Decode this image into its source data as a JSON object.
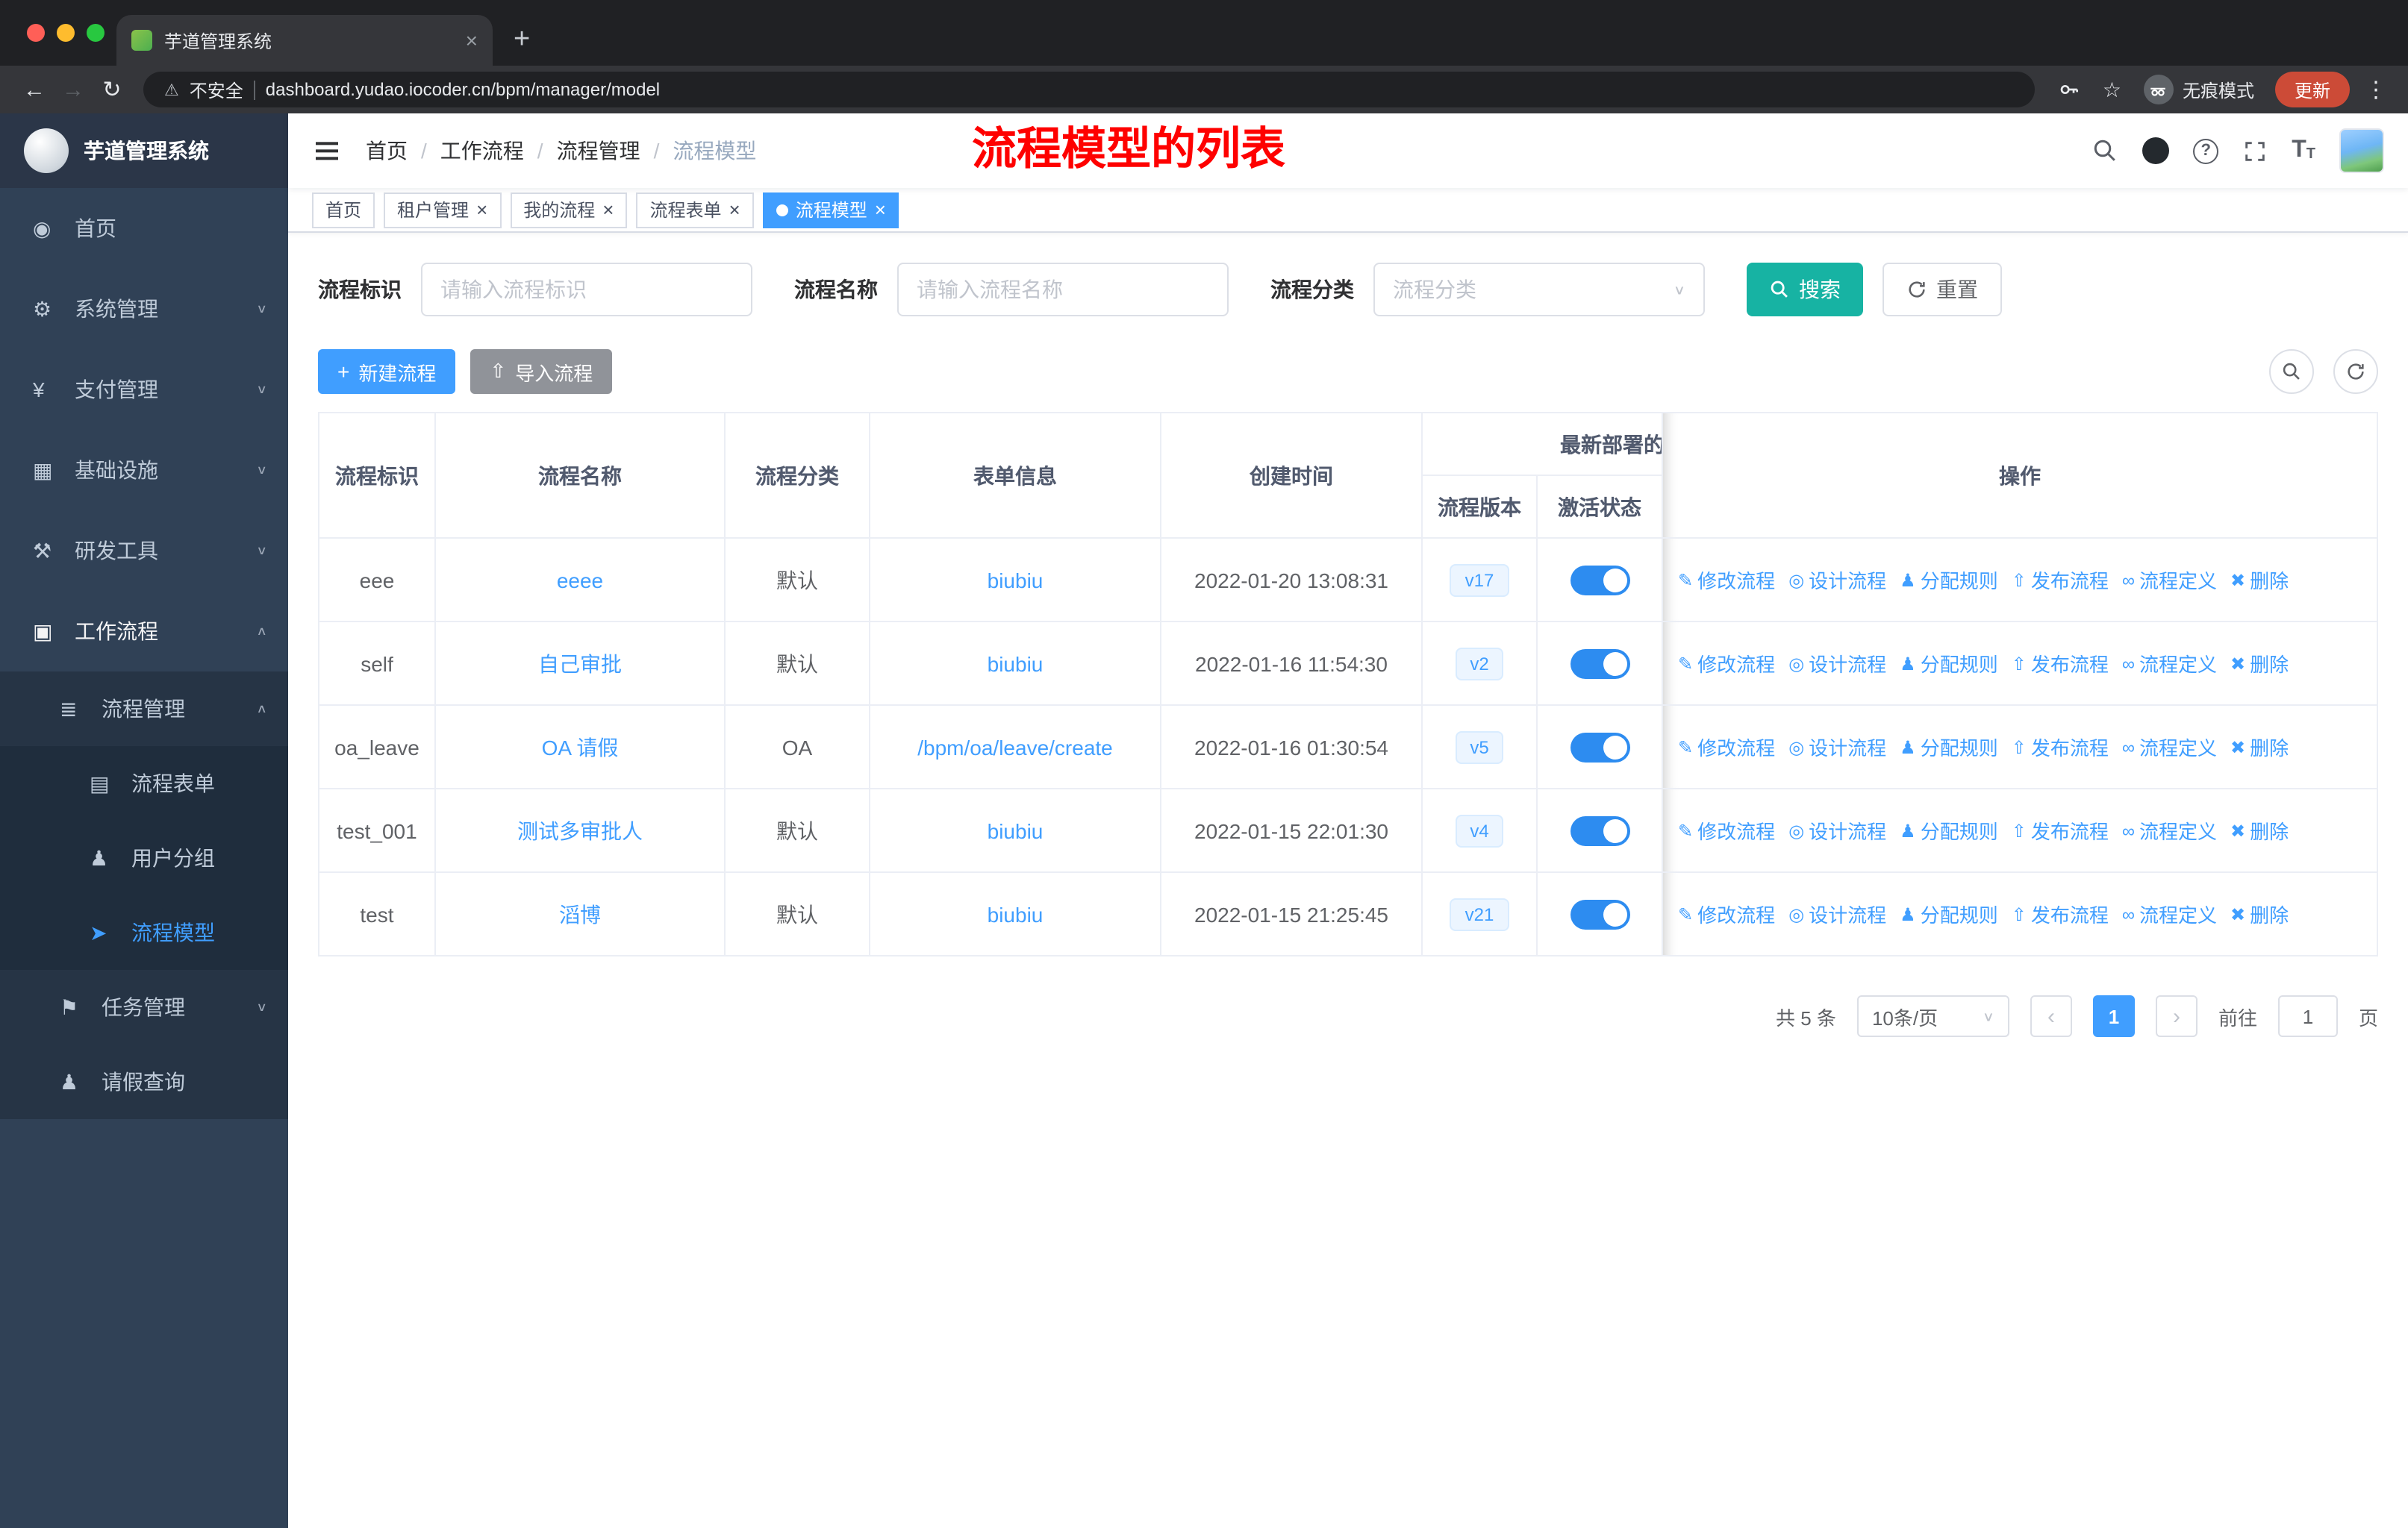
{
  "browser": {
    "tab_title": "芋道管理系统",
    "security_label": "不安全",
    "url": "dashboard.yudao.iocoder.cn/bpm/manager/model",
    "incognito_label": "无痕模式",
    "update_label": "更新"
  },
  "icons": {
    "back": "←",
    "forward": "→",
    "reload": "↻",
    "warning": "⚠",
    "star": "☆",
    "kebab": "⋮",
    "new_tab": "+",
    "close": "×",
    "plus": "+",
    "upload": "⇧",
    "chevron_down": "∨",
    "chevron_up": "∧",
    "prev": "‹",
    "next": "›",
    "help": "?",
    "font_size": "T"
  },
  "sidebar": {
    "logo_title": "芋道管理系统",
    "items": [
      {
        "name": "home",
        "label": "首页",
        "glyph": "◉",
        "level": 1
      },
      {
        "name": "system-management",
        "label": "系统管理",
        "glyph": "⚙",
        "level": 1,
        "chevron": "down"
      },
      {
        "name": "payment-management",
        "label": "支付管理",
        "glyph": "¥",
        "level": 1,
        "chevron": "down"
      },
      {
        "name": "infrastructure",
        "label": "基础设施",
        "glyph": "▦",
        "level": 1,
        "chevron": "down"
      },
      {
        "name": "dev-tools",
        "label": "研发工具",
        "glyph": "⚒",
        "level": 1,
        "chevron": "down"
      },
      {
        "name": "workflow",
        "label": "工作流程",
        "glyph": "▣",
        "level": 1,
        "chevron": "up",
        "highlight": true
      },
      {
        "name": "process-management",
        "label": "流程管理",
        "glyph": "≣",
        "level": 2,
        "chevron": "up"
      },
      {
        "name": "process-form",
        "label": "流程表单",
        "glyph": "▤",
        "level": 3
      },
      {
        "name": "user-group",
        "label": "用户分组",
        "glyph": "♟",
        "level": 3
      },
      {
        "name": "process-model",
        "label": "流程模型",
        "glyph": "➤",
        "level": 3,
        "active": true
      },
      {
        "name": "task-management",
        "label": "任务管理",
        "glyph": "⚑",
        "level": 2,
        "chevron": "down"
      },
      {
        "name": "leave-query",
        "label": "请假查询",
        "glyph": "♟",
        "level": 2
      }
    ]
  },
  "header": {
    "breadcrumb": [
      "首页",
      "工作流程",
      "流程管理",
      "流程模型"
    ],
    "breadcrumb_separator": "/",
    "annotation": "流程模型的列表"
  },
  "tags": [
    {
      "label": "首页",
      "closable": false,
      "active": false
    },
    {
      "label": "租户管理",
      "closable": true,
      "active": false
    },
    {
      "label": "我的流程",
      "closable": true,
      "active": false
    },
    {
      "label": "流程表单",
      "closable": true,
      "active": false
    },
    {
      "label": "流程模型",
      "closable": true,
      "active": true
    }
  ],
  "filters": {
    "key_label": "流程标识",
    "key_placeholder": "请输入流程标识",
    "name_label": "流程名称",
    "name_placeholder": "请输入流程名称",
    "category_label": "流程分类",
    "category_placeholder": "流程分类",
    "search_label": "搜索",
    "reset_label": "重置"
  },
  "toolbar": {
    "create_label": "新建流程",
    "import_label": "导入流程"
  },
  "table": {
    "headers": {
      "key": "流程标识",
      "name": "流程名称",
      "category": "流程分类",
      "form": "表单信息",
      "create_time": "创建时间",
      "deploy_group": "最新部署的",
      "version": "流程版本",
      "status": "激活状态",
      "actions": "操作"
    },
    "rows": [
      {
        "key": "eee",
        "name": "eeee",
        "category": "默认",
        "form": "biubiu",
        "time": "2022-01-20 13:08:31",
        "version": "v17",
        "active": true
      },
      {
        "key": "self",
        "name": "自己审批",
        "category": "默认",
        "form": "biubiu",
        "time": "2022-01-16 11:54:30",
        "version": "v2",
        "active": true
      },
      {
        "key": "oa_leave",
        "name": "OA 请假",
        "category": "OA",
        "form": "/bpm/oa/leave/create",
        "time": "2022-01-16 01:30:54",
        "version": "v5",
        "active": true
      },
      {
        "key": "test_001",
        "name": "测试多审批人",
        "category": "默认",
        "form": "biubiu",
        "time": "2022-01-15 22:01:30",
        "version": "v4",
        "active": true
      },
      {
        "key": "test",
        "name": "滔博",
        "category": "默认",
        "form": "biubiu",
        "time": "2022-01-15 21:25:45",
        "version": "v21",
        "active": true
      }
    ],
    "row_actions": [
      {
        "name": "edit-process",
        "label": "修改流程",
        "glyph": "✎"
      },
      {
        "name": "design-process",
        "label": "设计流程",
        "glyph": "◎"
      },
      {
        "name": "assign-rule",
        "label": "分配规则",
        "glyph": "♟"
      },
      {
        "name": "publish-process",
        "label": "发布流程",
        "glyph": "⇧"
      },
      {
        "name": "process-definition",
        "label": "流程定义",
        "glyph": "∞"
      },
      {
        "name": "delete-process",
        "label": "删除",
        "glyph": "✖"
      }
    ]
  },
  "pagination": {
    "total": "共 5 条",
    "page_size": "10条/页",
    "current_page": "1",
    "goto_label": "前往",
    "goto_value": "1",
    "page_unit": "页"
  },
  "colors": {
    "primary": "#409eff",
    "link": "#409eff",
    "search_button": "#17b3a3",
    "sidebar_bg": "#304156",
    "sidebar_sub_bg": "#263445",
    "sidebar_subsub_bg": "#1f2d3d",
    "annotation_red": "#fe0100",
    "toggle_on": "#2d8cf0",
    "tag_active": "#409eff",
    "update_chip": "#cc4b37",
    "chrome_dark": "#202124",
    "chrome_toolbar": "#35363a",
    "version_badge_bg": "#ecf5ff"
  }
}
